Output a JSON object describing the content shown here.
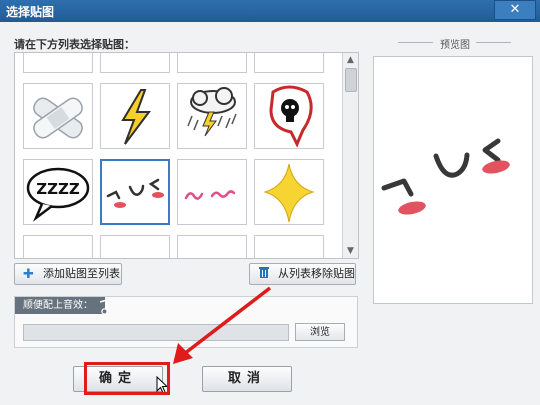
{
  "window": {
    "title": "选择贴图",
    "close_glyph": "✕"
  },
  "prompt": "请在下方列表选择贴图：",
  "stickers": [
    {
      "name": "cloud-sticker"
    },
    {
      "name": "ellipse-sticker"
    },
    {
      "name": "bubble-sticker"
    },
    {
      "name": "no-sign-sticker"
    },
    {
      "name": "bandage-sticker"
    },
    {
      "name": "lightning-sticker"
    },
    {
      "name": "storm-cloud-sticker"
    },
    {
      "name": "skull-bubble-sticker"
    },
    {
      "name": "zzz-bubble-sticker"
    },
    {
      "name": "blush-face-sticker"
    },
    {
      "name": "pink-blush-sticker"
    },
    {
      "name": "star-sticker"
    },
    {
      "name": "burst-sticker"
    },
    {
      "name": "pointing-hand-sticker"
    },
    {
      "name": "pointing-hand-sticker"
    },
    {
      "name": "pointing-hand-sticker"
    }
  ],
  "sticker_text": {
    "zzz": "ZZZZ"
  },
  "selected_index": 9,
  "buttons": {
    "add": "添加贴图至列表",
    "remove": "从列表移除贴图",
    "ok": "确定",
    "cancel": "取消",
    "browse": "浏览"
  },
  "sound": {
    "label": "顺便配上音效：",
    "value": ""
  },
  "preview": {
    "title": "预览图"
  },
  "colors": {
    "title_bar": "#2766a5",
    "selection": "#3a7bc8",
    "annotation_red": "#e01b1b"
  }
}
